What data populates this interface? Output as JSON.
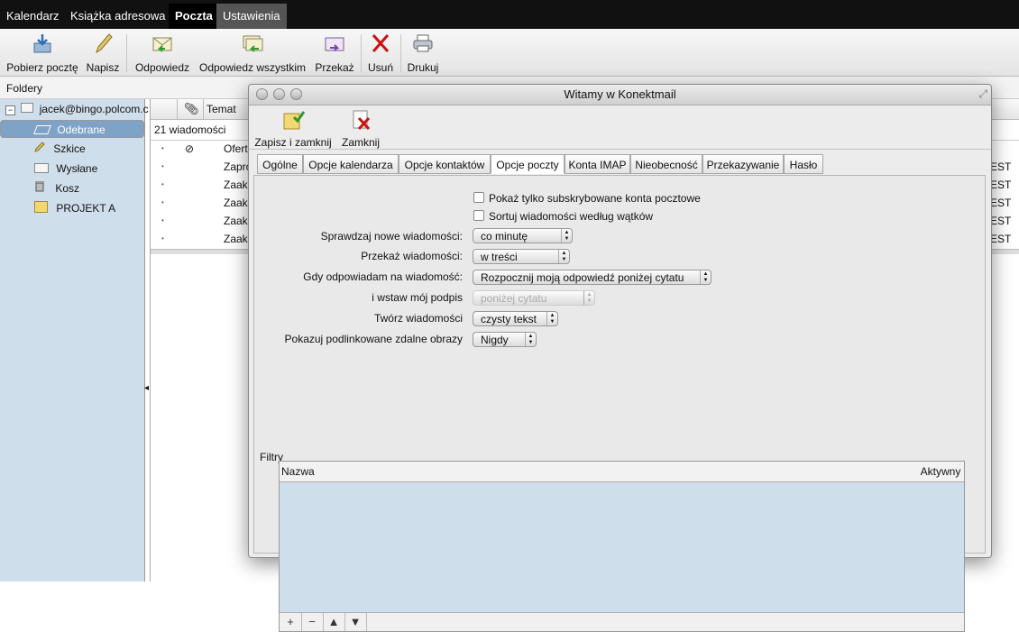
{
  "topnav": {
    "tabs": [
      "Kalendarz",
      "Książka adresowa",
      "Poczta",
      "Ustawienia"
    ]
  },
  "toolbar": {
    "buttons": [
      "Pobierz pocztę",
      "Napisz",
      "Odpowiedz",
      "Odpowiedz wszystkim",
      "Przekaż",
      "Usuń",
      "Drukuj"
    ]
  },
  "folders": {
    "label": "Foldery",
    "account": "jacek@bingo.polcom.c",
    "items": [
      "Odebrane",
      "Szkice",
      "Wysłane",
      "Kosz",
      "PROJEKT A"
    ]
  },
  "messages": {
    "header_subject": "Temat",
    "count": "21 wiadomości",
    "subjects": [
      "Ofert",
      "Zapro",
      "Zaak",
      "Zaak",
      "Zaak",
      "Zaak"
    ],
    "right_cells": [
      "EST",
      "EST",
      "EST",
      "EST",
      "EST"
    ]
  },
  "dialog": {
    "title": "Witamy w Konektmail",
    "buttons": [
      "Zapisz i zamknij",
      "Zamknij"
    ],
    "tabs": [
      "Ogólne",
      "Opcje kalendarza",
      "Opcje kontaktów",
      "Opcje poczty",
      "Konta IMAP",
      "Nieobecność",
      "Przekazywanie",
      "Hasło"
    ],
    "checkboxes": [
      "Pokaż tylko subskrybowane konta pocztowe",
      "Sortuj wiadomości według wątków"
    ],
    "fields": [
      {
        "label": "Sprawdzaj nowe wiadomości:",
        "value": "co minutę"
      },
      {
        "label": "Przekaż wiadomości:",
        "value": "w treści"
      },
      {
        "label": "Gdy odpowiadam na wiadomość:",
        "value": "Rozpocznij moją odpowiedź poniżej cytatu"
      },
      {
        "label": "i wstaw mój podpis",
        "value": "poniżej cytatu"
      },
      {
        "label": "Twórz wiadomości",
        "value": "czysty tekst"
      },
      {
        "label": "Pokazuj podlinkowane zdalne obrazy",
        "value": "Nigdy"
      }
    ],
    "filters": {
      "label": "Filtry",
      "col_name": "Nazwa",
      "col_active": "Aktywny",
      "controls": [
        "+",
        "−",
        "▲",
        "▼"
      ]
    }
  },
  "colors": {
    "topnav_bg": "#111111",
    "sidebar_bg": "#cfdeeb",
    "selected_row": "#7fa3c7",
    "delete_icon": "#cc1111"
  },
  "icons": [
    "download-mail-icon",
    "pencil-icon",
    "reply-icon",
    "reply-all-icon",
    "forward-icon",
    "delete-x-icon",
    "printer-icon",
    "save-close-icon",
    "close-doc-icon",
    "paperclip-icon"
  ]
}
